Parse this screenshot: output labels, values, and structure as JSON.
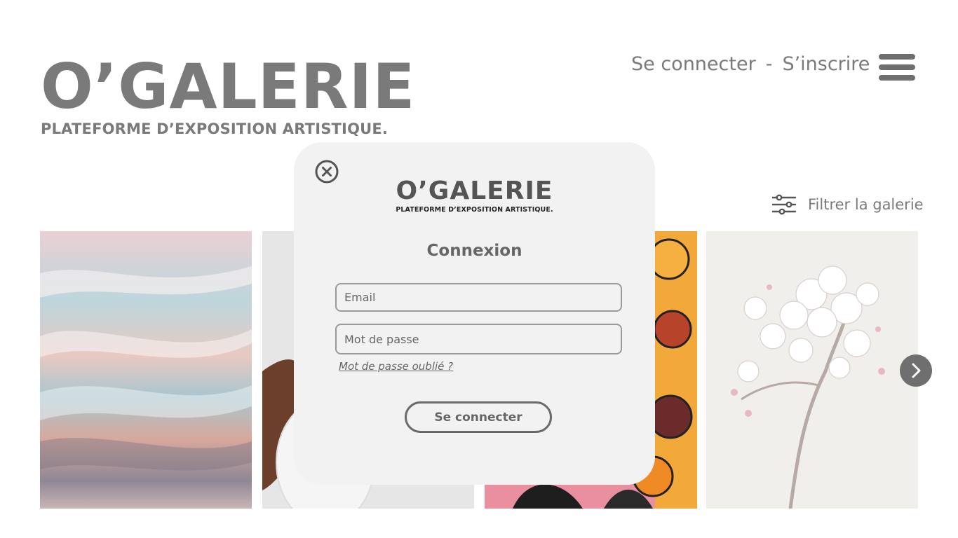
{
  "header": {
    "brand_title": "O’GALERIE",
    "brand_subtitle": "PLATEFORME D’EXPOSITION ARTISTIQUE.",
    "login_link": "Se connecter",
    "separator": "-",
    "signup_link": "S’inscrire",
    "menu_icon": "hamburger-menu-icon"
  },
  "filter": {
    "label": "Filtrer la galerie",
    "icon": "sliders-icon"
  },
  "gallery": {
    "artworks": [
      {
        "name": "marbled-pink-blue-abstract"
      },
      {
        "name": "hand-white-vase"
      },
      {
        "name": "colorful-faces-mural"
      },
      {
        "name": "cherry-blossom-branch-drawing"
      }
    ],
    "next_icon": "chevron-right-icon"
  },
  "modal": {
    "close_icon": "close-circle-icon",
    "logo_title": "O’GALERIE",
    "logo_subtitle": "PLATEFORME D’EXPOSITION ARTISTIQUE.",
    "heading": "Connexion",
    "email_placeholder": "Email",
    "password_placeholder": "Mot de passe",
    "forgot_link": "Mot de passe oublié ?",
    "submit_label": "Se connecter"
  }
}
